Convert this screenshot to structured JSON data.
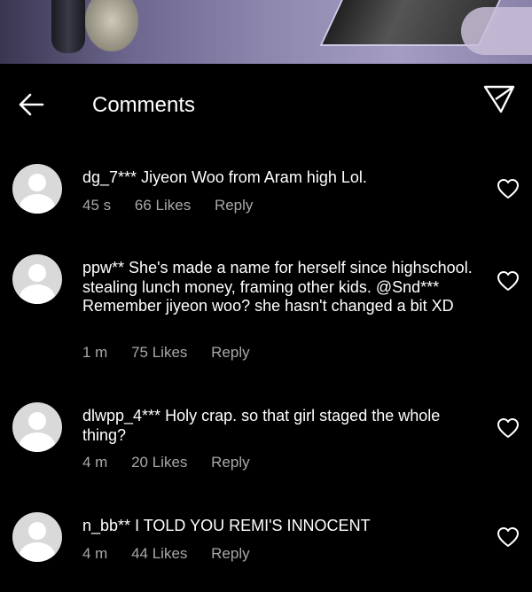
{
  "header": {
    "title": "Comments"
  },
  "comments": [
    {
      "username": "dg_7***",
      "text": "Jiyeon Woo from Aram high Lol.",
      "time": "45 s",
      "likes": "66 Likes",
      "reply_label": "Reply"
    },
    {
      "username": "ppw**",
      "text": "She's made a name for herself since highschool. stealing lunch money, framing other kids. @Snd*** Remember jiyeon woo? she hasn't changed a bit XD",
      "time": "1 m",
      "likes": "75 Likes",
      "reply_label": "Reply"
    },
    {
      "username": "dlwpp_4***",
      "text": "Holy crap. so that girl staged the whole thing?",
      "time": "4 m",
      "likes": "20 Likes",
      "reply_label": "Reply"
    },
    {
      "username": "n_bb**",
      "text": "I TOLD YOU REMI'S INNOCENT",
      "time": "4 m",
      "likes": "44 Likes",
      "reply_label": "Reply"
    }
  ]
}
